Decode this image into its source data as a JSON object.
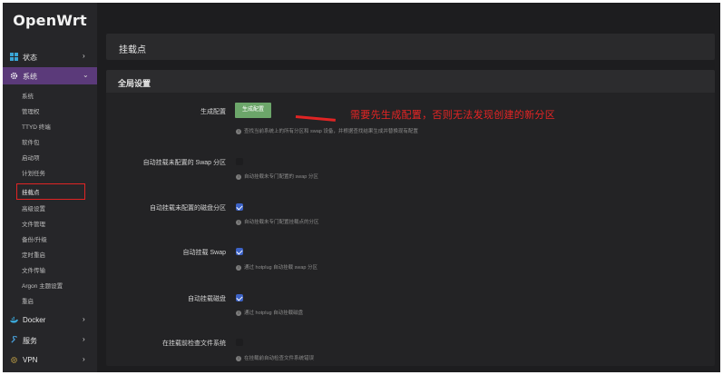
{
  "app": {
    "logo": "OpenWrt"
  },
  "sidebar": {
    "groups": [
      {
        "label": "状态",
        "icon": "dashboard-icon"
      },
      {
        "label": "系统",
        "icon": "gear-icon"
      },
      {
        "label": "Docker",
        "icon": "docker-icon"
      },
      {
        "label": "服务",
        "icon": "services-icon"
      },
      {
        "label": "VPN",
        "icon": "vpn-icon"
      }
    ],
    "system_items": [
      "系统",
      "管理权",
      "TTYD 终端",
      "软件包",
      "启动项",
      "计划任务",
      "挂载点",
      "高级设置",
      "文件管理",
      "备份/升级",
      "定时重启",
      "文件传输",
      "Argon 主题设置",
      "重启"
    ]
  },
  "page": {
    "title": "挂载点"
  },
  "section": {
    "title": "全局设置",
    "rows": [
      {
        "label": "生成配置",
        "button_label": "生成配置",
        "desc": "查找当前系统上的所有分区和 swap 设备，并根据查找结果生成并替换现有配置"
      },
      {
        "label": "自动挂载未配置的 Swap 分区",
        "checked": false,
        "desc": "自动挂载未专门配置的 swap 分区"
      },
      {
        "label": "自动挂载未配置的磁盘分区",
        "checked": true,
        "desc": "自动挂载未专门配置挂载点的分区"
      },
      {
        "label": "自动挂载 Swap",
        "checked": true,
        "desc": "通过 hotplug 自动挂载 swap 分区"
      },
      {
        "label": "自动挂载磁盘",
        "checked": true,
        "desc": "通过 hotplug 自动挂载磁盘"
      },
      {
        "label": "在挂载前检查文件系统",
        "checked": false,
        "desc": "在挂载前自动检查文件系统错误"
      }
    ]
  },
  "annotation": {
    "text": "需要先生成配置，否则无法发现创建的新分区"
  },
  "colors": {
    "accent": "#5b3a7a",
    "button": "#6ca66a",
    "checkbox": "#3d63c7",
    "annotation": "#e02424"
  }
}
